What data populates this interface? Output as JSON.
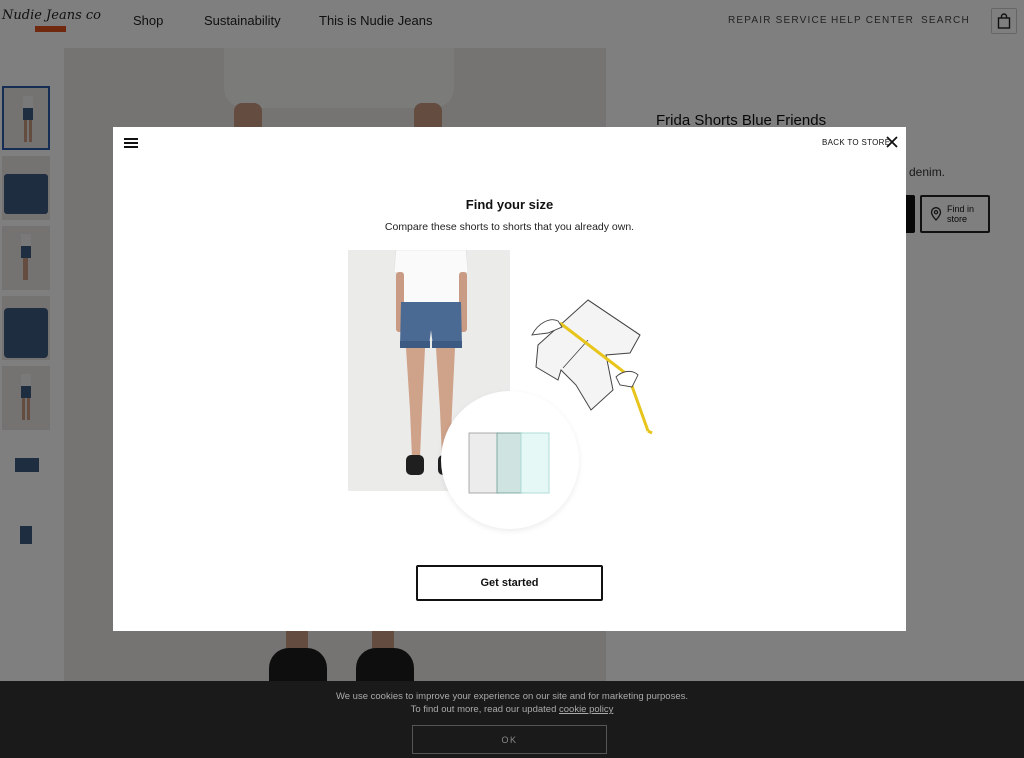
{
  "header": {
    "logo_text": "Nudie Jeans co",
    "nav": [
      "Shop",
      "Sustainability",
      "This is Nudie Jeans"
    ],
    "utility": [
      "REPAIR SERVICE",
      "HELP CENTER",
      "SEARCH"
    ],
    "accent_color": "#e0521f"
  },
  "product": {
    "title": "Frida Shorts Blue Friends",
    "desc_fragment": "denim.",
    "find_store_label": "Find in store"
  },
  "modal": {
    "back_label": "BACK TO STORE",
    "title": "Find your size",
    "subtitle": "Compare these shorts to shorts that you already own.",
    "cta_label": "Get started"
  },
  "cookie": {
    "line1": "We use cookies to improve your experience on our site and for marketing purposes.",
    "line2_prefix": "To find out more, read our updated",
    "link_label": "cookie policy",
    "ok_label": "OK"
  }
}
